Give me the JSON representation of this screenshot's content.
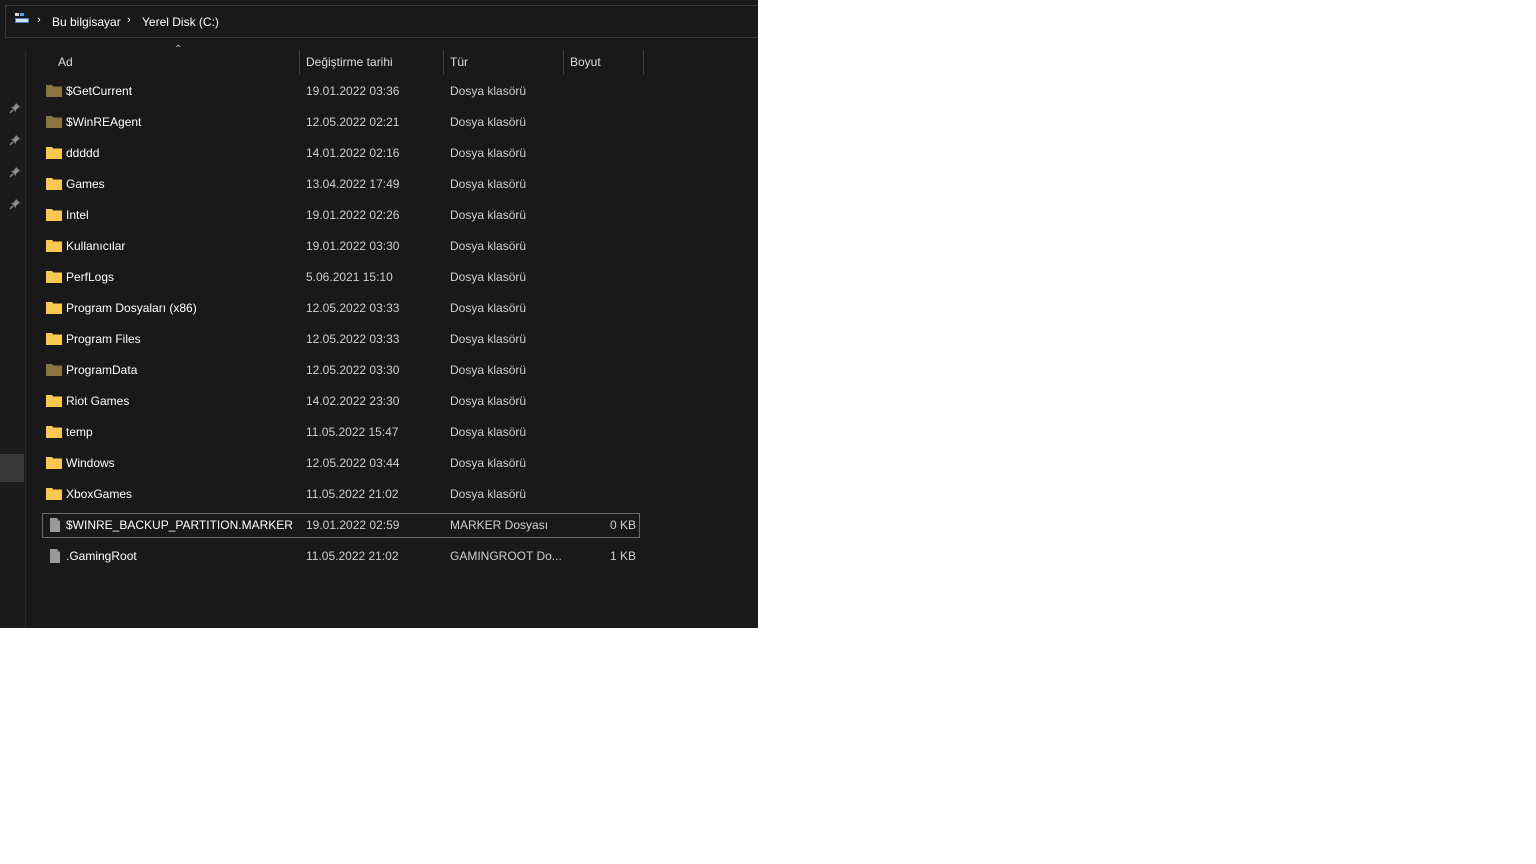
{
  "breadcrumb": {
    "items": [
      "Bu bilgisayar",
      "Yerel Disk (C:)"
    ],
    "separator": "›"
  },
  "columns": {
    "name": "Ad",
    "date": "Değiştirme tarihi",
    "type": "Tür",
    "size": "Boyut",
    "sort_indicator": "⌃"
  },
  "files": [
    {
      "name": "$GetCurrent",
      "date": "19.01.2022 03:36",
      "type": "Dosya klasörü",
      "size": "",
      "icon": "folder-hidden-icon"
    },
    {
      "name": "$WinREAgent",
      "date": "12.05.2022 02:21",
      "type": "Dosya klasörü",
      "size": "",
      "icon": "folder-hidden-icon"
    },
    {
      "name": "ddddd",
      "date": "14.01.2022 02:16",
      "type": "Dosya klasörü",
      "size": "",
      "icon": "folder-icon"
    },
    {
      "name": "Games",
      "date": "13.04.2022 17:49",
      "type": "Dosya klasörü",
      "size": "",
      "icon": "folder-icon"
    },
    {
      "name": "Intel",
      "date": "19.01.2022 02:26",
      "type": "Dosya klasörü",
      "size": "",
      "icon": "folder-icon"
    },
    {
      "name": "Kullanıcılar",
      "date": "19.01.2022 03:30",
      "type": "Dosya klasörü",
      "size": "",
      "icon": "folder-icon"
    },
    {
      "name": "PerfLogs",
      "date": "5.06.2021 15:10",
      "type": "Dosya klasörü",
      "size": "",
      "icon": "folder-icon"
    },
    {
      "name": "Program Dosyaları (x86)",
      "date": "12.05.2022 03:33",
      "type": "Dosya klasörü",
      "size": "",
      "icon": "folder-icon"
    },
    {
      "name": "Program Files",
      "date": "12.05.2022 03:33",
      "type": "Dosya klasörü",
      "size": "",
      "icon": "folder-icon"
    },
    {
      "name": "ProgramData",
      "date": "12.05.2022 03:30",
      "type": "Dosya klasörü",
      "size": "",
      "icon": "folder-hidden-icon"
    },
    {
      "name": "Riot Games",
      "date": "14.02.2022 23:30",
      "type": "Dosya klasörü",
      "size": "",
      "icon": "folder-icon"
    },
    {
      "name": "temp",
      "date": "11.05.2022 15:47",
      "type": "Dosya klasörü",
      "size": "",
      "icon": "folder-icon"
    },
    {
      "name": "Windows",
      "date": "12.05.2022 03:44",
      "type": "Dosya klasörü",
      "size": "",
      "icon": "folder-icon"
    },
    {
      "name": "XboxGames",
      "date": "11.05.2022 21:02",
      "type": "Dosya klasörü",
      "size": "",
      "icon": "folder-icon"
    },
    {
      "name": "$WINRE_BACKUP_PARTITION.MARKER",
      "date": "19.01.2022 02:59",
      "type": "MARKER Dosyası",
      "size": "0 KB",
      "icon": "file-icon",
      "focused": true
    },
    {
      "name": ".GamingRoot",
      "date": "11.05.2022 21:02",
      "type": "GAMINGROOT Do...",
      "size": "1 KB",
      "icon": "file-icon"
    }
  ],
  "colors": {
    "window_bg": "#191919",
    "folder": "#f8c850",
    "folder_hidden": "#8a7440",
    "file": "#9a9a9a"
  }
}
